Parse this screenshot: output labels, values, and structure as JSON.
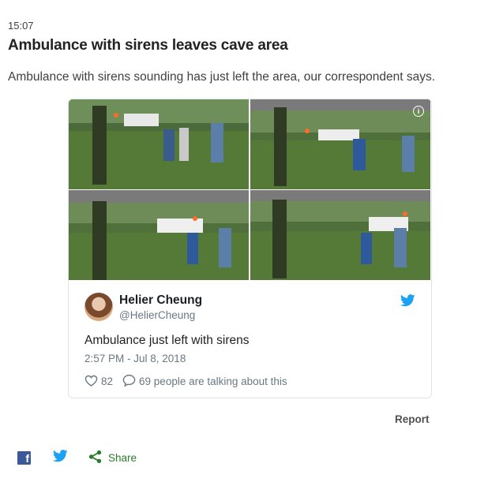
{
  "post": {
    "time": "15:07",
    "headline": "Ambulance with sirens leaves cave area",
    "summary": "Ambulance with sirens sounding has just left the area, our correspondent says."
  },
  "tweet": {
    "display_name": "Helier Cheung",
    "handle": "@HelierCheung",
    "text": "Ambulance just left with sirens",
    "timestamp": "2:57 PM - Jul 8, 2018",
    "likes": "82",
    "talking": "69 people are talking about this"
  },
  "footer": {
    "report_label": "Report",
    "share_label": "Share"
  },
  "colors": {
    "facebook": "#3b5998",
    "twitter": "#1da1f2",
    "share_green": "#2a7d2a"
  },
  "icons": [
    "info-icon",
    "twitter-bird-icon",
    "heart-icon",
    "speech-bubble-icon",
    "facebook-icon",
    "share-icon"
  ]
}
